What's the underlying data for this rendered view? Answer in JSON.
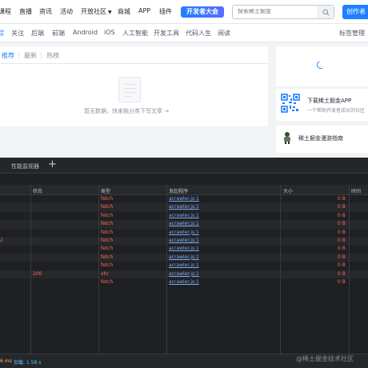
{
  "topnav": {
    "items": [
      "课程",
      "直播",
      "资讯",
      "活动",
      "开放社区",
      "商城",
      "APP",
      "插件"
    ],
    "promo": "开发者大会",
    "search_placeholder": "探索稀土掘金",
    "creator_button": "创作者"
  },
  "categories": {
    "items": [
      "关注",
      "后端",
      "前端",
      "Android",
      "iOS",
      "人工智能",
      "开发工具",
      "代码人生",
      "阅读"
    ],
    "active_partial": "综",
    "right": "标签管理"
  },
  "feed": {
    "tabs": [
      "推荐",
      "最新",
      "热榜"
    ],
    "empty_text": "暂无数据，快来挑分类下写文章 →"
  },
  "sidebar": {
    "app_title": "下载稀土掘金APP",
    "app_subtitle": "一个帮助开发者成长的社区",
    "guide": "稀土掘金漫游指南"
  },
  "devtools": {
    "tab": "性能监视器",
    "add": "+",
    "columns": {
      "status": "状态",
      "type": "类型",
      "initiator": "发起程序",
      "size": "大小",
      "time": "时间"
    },
    "rows": [
      {
        "edge": "",
        "status": "",
        "type": "fetch",
        "initiator": "acrawler.js:1",
        "size": "0 B"
      },
      {
        "edge": "",
        "status": "",
        "type": "fetch",
        "initiator": "acrawler.js:1",
        "size": "0 B"
      },
      {
        "edge": "",
        "status": "",
        "type": "fetch",
        "initiator": "acrawler.js:1",
        "size": "0 B"
      },
      {
        "edge": "",
        "status": "",
        "type": "fetch",
        "initiator": "acrawler.js:1",
        "size": "0 B"
      },
      {
        "edge": "",
        "status": "",
        "type": "fetch",
        "initiator": "acrawler.js:1",
        "size": "0 B"
      },
      {
        "edge": "2",
        "status": "",
        "type": "fetch",
        "initiator": "acrawler.js:1",
        "size": "0 B"
      },
      {
        "edge": "",
        "status": "",
        "type": "fetch",
        "initiator": "acrawler.js:1",
        "size": "0 B"
      },
      {
        "edge": "",
        "status": "",
        "type": "fetch",
        "initiator": "acrawler.js:1",
        "size": "0 B"
      },
      {
        "edge": "",
        "status": "",
        "type": "fetch",
        "initiator": "acrawler.js:1",
        "size": "0 B"
      },
      {
        "edge": "",
        "status": "200",
        "type": "xhr",
        "initiator": "acrawler.js:1",
        "size": "0 B"
      },
      {
        "edge": "",
        "status": "",
        "type": "fetch",
        "initiator": "acrawler.js:1",
        "size": "0 B"
      }
    ],
    "status_text": "6 ms",
    "loaded_text": "加载: 1.58 s"
  },
  "watermark": "@稀土掘金技术社区",
  "colors": {
    "accent": "#1e80ff",
    "error": "#ff6b5a",
    "link": "#7cacf8"
  }
}
